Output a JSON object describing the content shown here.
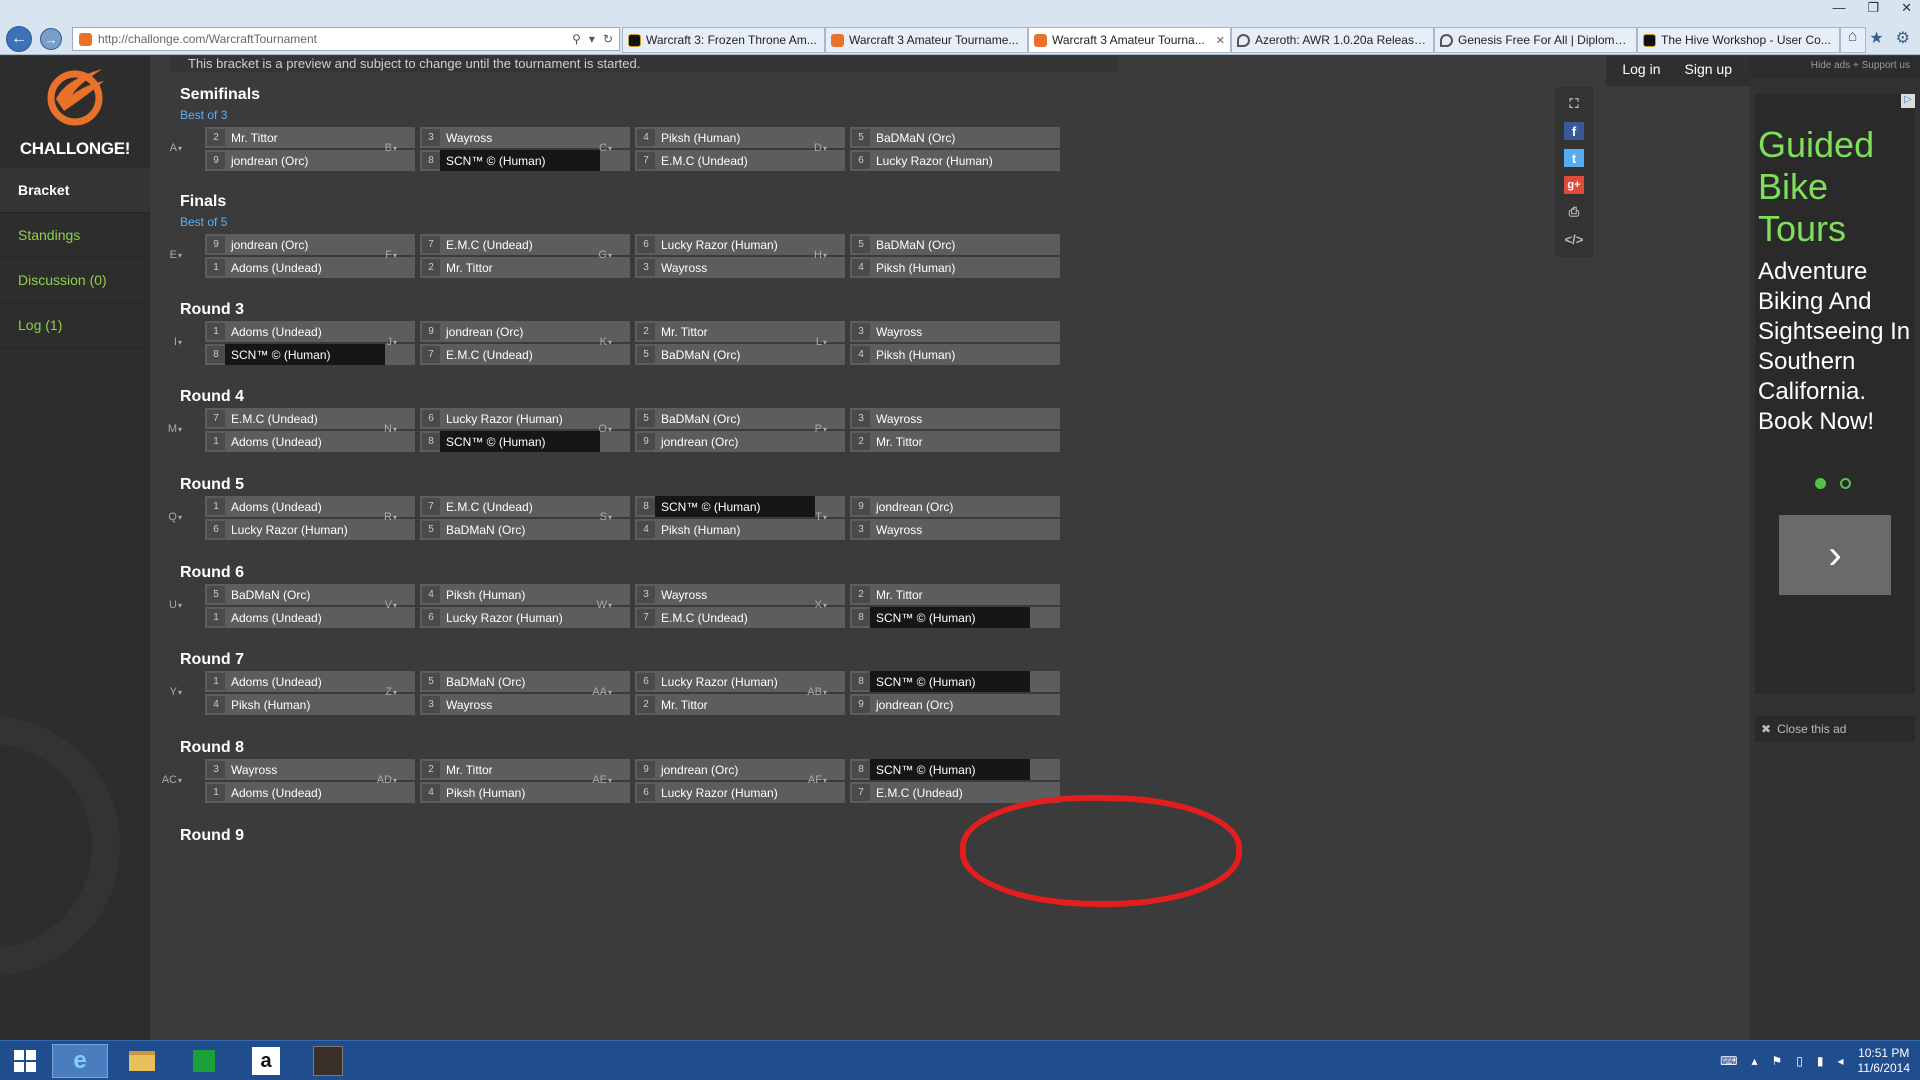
{
  "browser": {
    "url": "http://challonge.com/WarcraftTournament",
    "tabs": [
      {
        "label": "Warcraft 3: Frozen Throne Am...",
        "icon": "hive-icon",
        "active": false
      },
      {
        "label": "Warcraft 3 Amateur Tourname...",
        "icon": "challonge-icon",
        "active": false
      },
      {
        "label": "Warcraft 3 Amateur Tourna...",
        "icon": "challonge-icon",
        "active": true
      },
      {
        "label": "Azeroth: AWR 1.0.20a Release ...",
        "icon": "diplomacy-icon",
        "active": false
      },
      {
        "label": "Genesis Free For All | Diplomu...",
        "icon": "diplomacy-icon",
        "active": false
      },
      {
        "label": "The Hive Workshop - User Co...",
        "icon": "hive-icon",
        "active": false
      }
    ]
  },
  "sidebar": {
    "logo_text": "CHALLONGE!",
    "items": [
      {
        "label": "Bracket",
        "active": true
      },
      {
        "label": "Standings",
        "active": false
      },
      {
        "label": "Discussion (0)",
        "active": false
      },
      {
        "label": "Log (1)",
        "active": false
      }
    ]
  },
  "main": {
    "notice": "This bracket is a preview and subject to change until the tournament is started.",
    "login": "Log in",
    "signup": "Sign up"
  },
  "rounds": [
    {
      "title": "Semifinals",
      "subtitle": "Best of 3",
      "matches": [
        {
          "id": "A",
          "p1": {
            "seed": "2",
            "name": "Mr. Tittor"
          },
          "p2": {
            "seed": "9",
            "name": "jondrean (Orc)"
          }
        },
        {
          "id": "B",
          "p1": {
            "seed": "3",
            "name": "Wayross"
          },
          "p2": {
            "seed": "8",
            "name": "SCN™ © (Human)",
            "dark": true
          }
        },
        {
          "id": "C",
          "p1": {
            "seed": "4",
            "name": "Piksh (Human)"
          },
          "p2": {
            "seed": "7",
            "name": "E.M.C (Undead)"
          }
        },
        {
          "id": "D",
          "p1": {
            "seed": "5",
            "name": "BaDMaN (Orc)"
          },
          "p2": {
            "seed": "6",
            "name": "Lucky Razor (Human)"
          }
        }
      ]
    },
    {
      "title": "Finals",
      "subtitle": "Best of 5",
      "matches": [
        {
          "id": "E",
          "p1": {
            "seed": "9",
            "name": "jondrean (Orc)"
          },
          "p2": {
            "seed": "1",
            "name": "Adoms (Undead)"
          }
        },
        {
          "id": "F",
          "p1": {
            "seed": "7",
            "name": "E.M.C (Undead)"
          },
          "p2": {
            "seed": "2",
            "name": "Mr. Tittor"
          }
        },
        {
          "id": "G",
          "p1": {
            "seed": "6",
            "name": "Lucky Razor (Human)"
          },
          "p2": {
            "seed": "3",
            "name": "Wayross"
          }
        },
        {
          "id": "H",
          "p1": {
            "seed": "5",
            "name": "BaDMaN (Orc)"
          },
          "p2": {
            "seed": "4",
            "name": "Piksh (Human)"
          }
        }
      ]
    },
    {
      "title": "Round 3",
      "subtitle": "",
      "matches": [
        {
          "id": "I",
          "p1": {
            "seed": "1",
            "name": "Adoms (Undead)"
          },
          "p2": {
            "seed": "8",
            "name": "SCN™ © (Human)",
            "dark": true
          }
        },
        {
          "id": "J",
          "p1": {
            "seed": "9",
            "name": "jondrean (Orc)"
          },
          "p2": {
            "seed": "7",
            "name": "E.M.C (Undead)"
          }
        },
        {
          "id": "K",
          "p1": {
            "seed": "2",
            "name": "Mr. Tittor"
          },
          "p2": {
            "seed": "5",
            "name": "BaDMaN (Orc)"
          }
        },
        {
          "id": "L",
          "p1": {
            "seed": "3",
            "name": "Wayross"
          },
          "p2": {
            "seed": "4",
            "name": "Piksh (Human)"
          }
        }
      ]
    },
    {
      "title": "Round 4",
      "subtitle": "",
      "matches": [
        {
          "id": "M",
          "p1": {
            "seed": "7",
            "name": "E.M.C (Undead)"
          },
          "p2": {
            "seed": "1",
            "name": "Adoms (Undead)"
          }
        },
        {
          "id": "N",
          "p1": {
            "seed": "6",
            "name": "Lucky Razor (Human)"
          },
          "p2": {
            "seed": "8",
            "name": "SCN™ © (Human)",
            "dark": true
          }
        },
        {
          "id": "O",
          "p1": {
            "seed": "5",
            "name": "BaDMaN (Orc)"
          },
          "p2": {
            "seed": "9",
            "name": "jondrean (Orc)"
          }
        },
        {
          "id": "P",
          "p1": {
            "seed": "3",
            "name": "Wayross"
          },
          "p2": {
            "seed": "2",
            "name": "Mr. Tittor"
          }
        }
      ]
    },
    {
      "title": "Round 5",
      "subtitle": "",
      "matches": [
        {
          "id": "Q",
          "p1": {
            "seed": "1",
            "name": "Adoms (Undead)"
          },
          "p2": {
            "seed": "6",
            "name": "Lucky Razor (Human)"
          }
        },
        {
          "id": "R",
          "p1": {
            "seed": "7",
            "name": "E.M.C (Undead)"
          },
          "p2": {
            "seed": "5",
            "name": "BaDMaN (Orc)"
          }
        },
        {
          "id": "S",
          "p1": {
            "seed": "8",
            "name": "SCN™ © (Human)",
            "dark": true
          },
          "p2": {
            "seed": "4",
            "name": "Piksh (Human)"
          }
        },
        {
          "id": "T",
          "p1": {
            "seed": "9",
            "name": "jondrean (Orc)"
          },
          "p2": {
            "seed": "3",
            "name": "Wayross"
          }
        }
      ]
    },
    {
      "title": "Round 6",
      "subtitle": "",
      "matches": [
        {
          "id": "U",
          "p1": {
            "seed": "5",
            "name": "BaDMaN (Orc)"
          },
          "p2": {
            "seed": "1",
            "name": "Adoms (Undead)"
          }
        },
        {
          "id": "V",
          "p1": {
            "seed": "4",
            "name": "Piksh (Human)"
          },
          "p2": {
            "seed": "6",
            "name": "Lucky Razor (Human)"
          }
        },
        {
          "id": "W",
          "p1": {
            "seed": "3",
            "name": "Wayross"
          },
          "p2": {
            "seed": "7",
            "name": "E.M.C (Undead)"
          }
        },
        {
          "id": "X",
          "p1": {
            "seed": "2",
            "name": "Mr. Tittor"
          },
          "p2": {
            "seed": "8",
            "name": "SCN™ © (Human)",
            "dark": true
          }
        }
      ]
    },
    {
      "title": "Round 7",
      "subtitle": "",
      "matches": [
        {
          "id": "Y",
          "p1": {
            "seed": "1",
            "name": "Adoms (Undead)"
          },
          "p2": {
            "seed": "4",
            "name": "Piksh (Human)"
          }
        },
        {
          "id": "Z",
          "p1": {
            "seed": "5",
            "name": "BaDMaN (Orc)"
          },
          "p2": {
            "seed": "3",
            "name": "Wayross"
          }
        },
        {
          "id": "AA",
          "p1": {
            "seed": "6",
            "name": "Lucky Razor (Human)"
          },
          "p2": {
            "seed": "2",
            "name": "Mr. Tittor"
          }
        },
        {
          "id": "AB",
          "p1": {
            "seed": "8",
            "name": "SCN™ © (Human)",
            "dark": true
          },
          "p2": {
            "seed": "9",
            "name": "jondrean (Orc)"
          }
        }
      ]
    },
    {
      "title": "Round 8",
      "subtitle": "",
      "matches": [
        {
          "id": "AC",
          "p1": {
            "seed": "3",
            "name": "Wayross"
          },
          "p2": {
            "seed": "1",
            "name": "Adoms (Undead)"
          }
        },
        {
          "id": "AD",
          "p1": {
            "seed": "2",
            "name": "Mr. Tittor"
          },
          "p2": {
            "seed": "4",
            "name": "Piksh (Human)"
          }
        },
        {
          "id": "AE",
          "p1": {
            "seed": "9",
            "name": "jondrean (Orc)"
          },
          "p2": {
            "seed": "6",
            "name": "Lucky Razor (Human)"
          }
        },
        {
          "id": "AF",
          "p1": {
            "seed": "8",
            "name": "SCN™ © (Human)",
            "dark": true
          },
          "p2": {
            "seed": "7",
            "name": "E.M.C (Undead)"
          }
        }
      ]
    },
    {
      "title": "Round 9",
      "subtitle": "",
      "matches": []
    }
  ],
  "share_icons": [
    "fullscreen-icon",
    "facebook-icon",
    "twitter-icon",
    "google-plus-icon",
    "print-icon",
    "embed-icon"
  ],
  "ad": {
    "top_text": "Hide ads + Support us",
    "headline": "Guided Bike Tours",
    "body": "Adventure Biking And Sightseeing In Southern California. Book Now!",
    "close_text": "Close this ad",
    "accent": "#7ee05a"
  },
  "taskbar": {
    "apps": [
      "internet-explorer-icon",
      "file-explorer-icon",
      "store-icon",
      "amazon-icon",
      "game-icon"
    ],
    "time": "10:51 PM",
    "date": "11/6/2014"
  },
  "colors": {
    "accent_green": "#8fd04a",
    "link_blue": "#5ab0ff",
    "annotation_red": "#e31e1e",
    "brand_orange": "#e8722a"
  }
}
